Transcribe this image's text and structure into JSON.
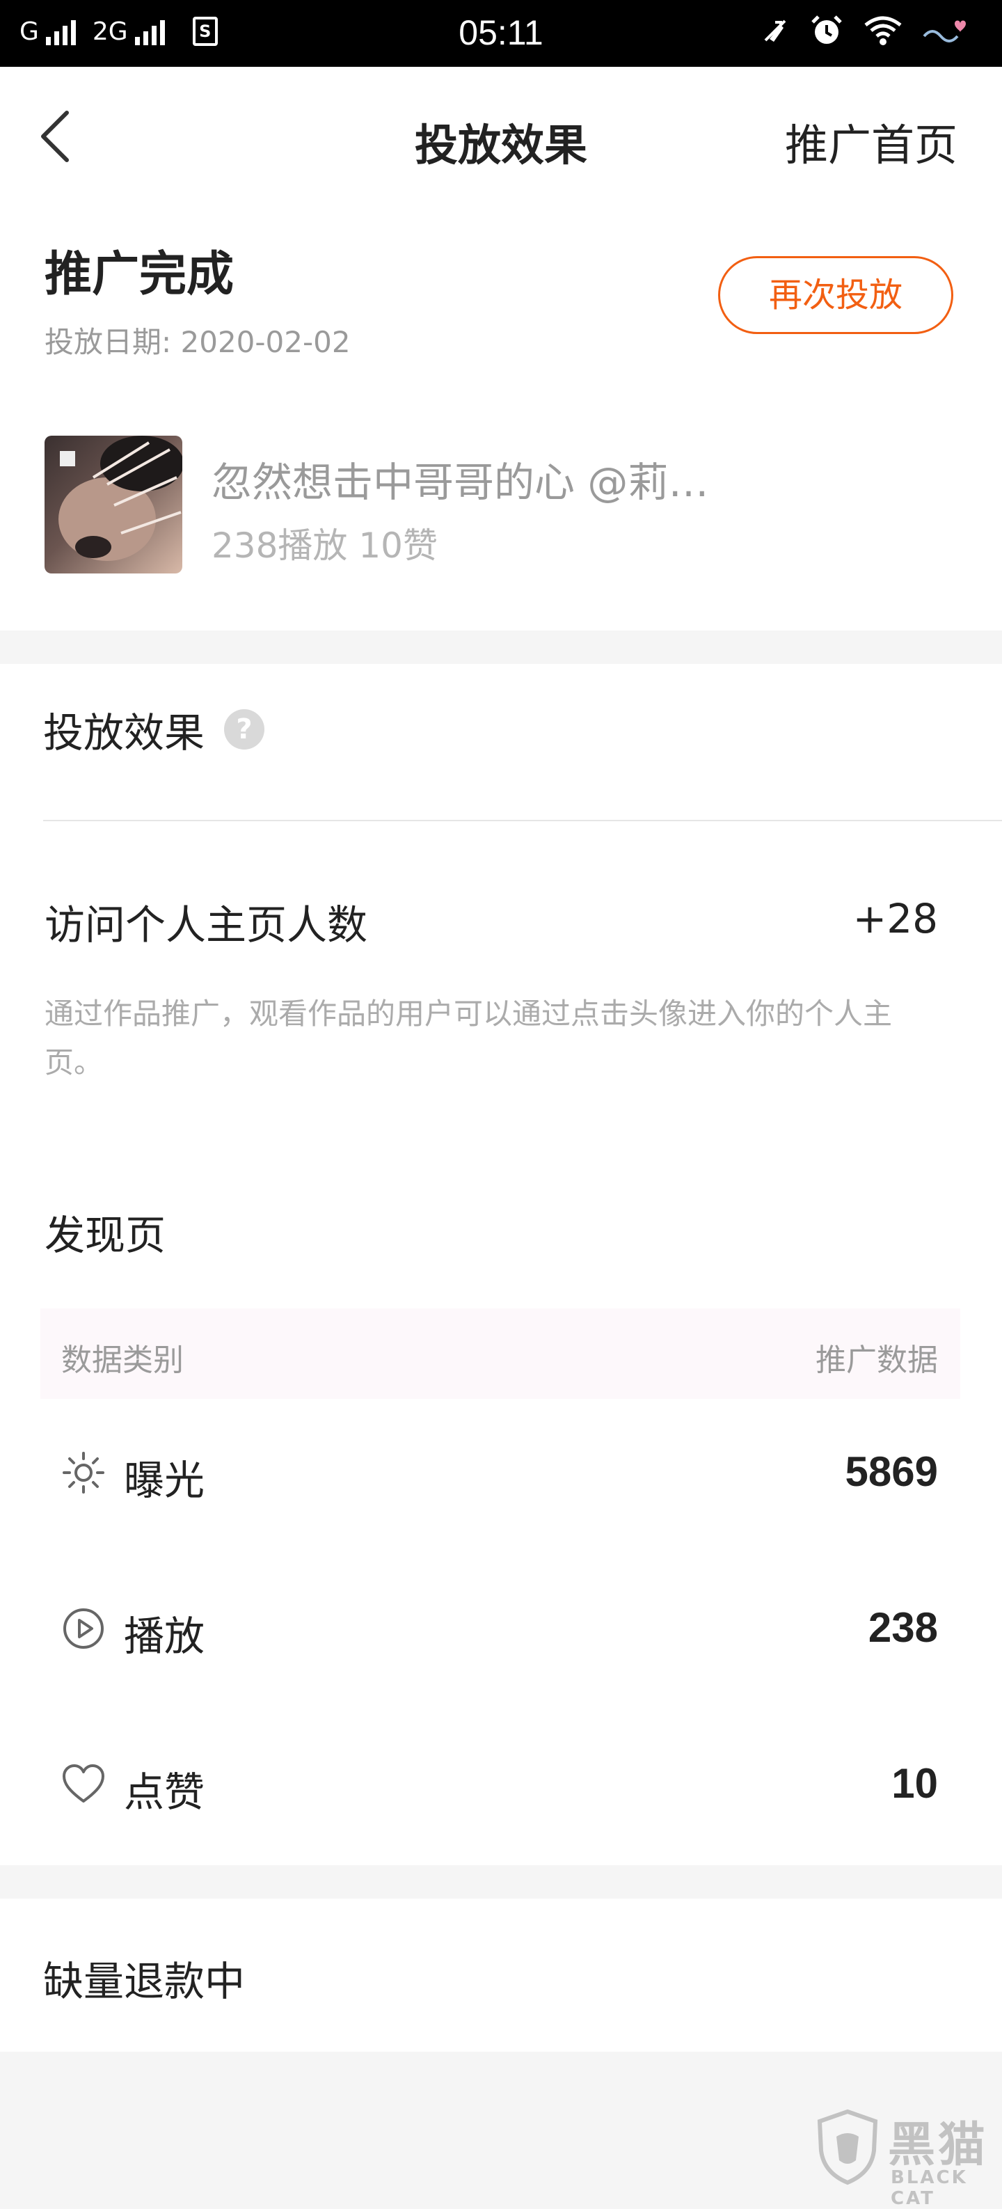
{
  "status_bar": {
    "carrier1": "G",
    "carrier2": "2G",
    "sim_badge": "S",
    "time": "05:11"
  },
  "header": {
    "title": "投放效果",
    "right_link": "推广首页"
  },
  "summary": {
    "status": "推广完成",
    "date": "投放日期: 2020-02-02",
    "retry_label": "再次投放"
  },
  "work": {
    "title": "忽然想击中哥哥的心 @莉…",
    "stats": "238播放  10赞"
  },
  "effect": {
    "heading": "投放效果",
    "help": "?",
    "visit_label": "访问个人主页人数",
    "visit_value": "+28",
    "visit_desc": "通过作品推广，观看作品的用户可以通过点击头像进入你的个人主页。"
  },
  "discover": {
    "title": "发现页",
    "col_category": "数据类别",
    "col_data": "推广数据",
    "rows": [
      {
        "icon": "sun-icon",
        "label": "曝光",
        "value": "5869"
      },
      {
        "icon": "play-icon",
        "label": "播放",
        "value": "238"
      },
      {
        "icon": "heart-icon",
        "label": "点赞",
        "value": "10"
      }
    ]
  },
  "refund": {
    "label": "缺量退款中"
  },
  "watermark": {
    "cn": "黑猫",
    "en": "BLACK CAT"
  },
  "colors": {
    "accent": "#f25f12",
    "muted_text": "#9a9a9a",
    "table_header_bg": "#fdf8fb"
  }
}
